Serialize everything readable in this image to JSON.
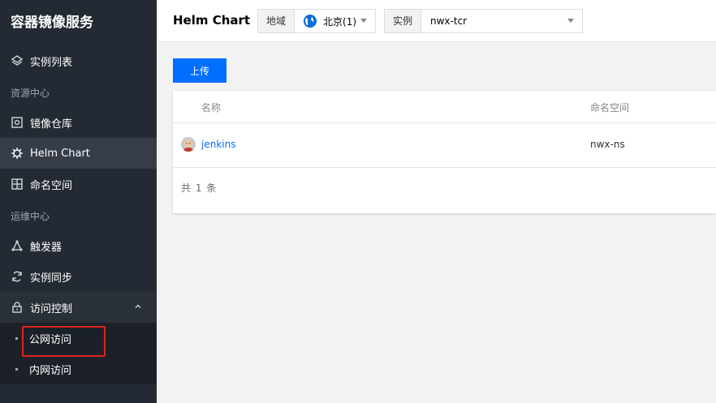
{
  "sidebar": {
    "app_title": "容器镜像服务",
    "top_item": {
      "label": "实例列表",
      "icon": "layers-icon"
    },
    "group_resources": "资源中心",
    "resources": [
      {
        "label": "镜像仓库",
        "icon": "repository-icon"
      },
      {
        "label": "Helm Chart",
        "icon": "helm-icon"
      },
      {
        "label": "命名空间",
        "icon": "namespace-icon"
      }
    ],
    "group_ops": "运维中心",
    "ops": [
      {
        "label": "触发器",
        "icon": "trigger-icon"
      },
      {
        "label": "实例同步",
        "icon": "sync-icon"
      },
      {
        "label": "访问控制",
        "icon": "lock-icon"
      }
    ],
    "access_sub": [
      {
        "label": "公网访问"
      },
      {
        "label": "内网访问"
      }
    ]
  },
  "header": {
    "title": "Helm Chart",
    "region_label": "地域",
    "region_value": "北京(1)",
    "instance_label": "实例",
    "instance_value": "nwx-tcr"
  },
  "toolbar": {
    "upload_label": "上传"
  },
  "table": {
    "columns": [
      "名称",
      "命名空间"
    ],
    "rows": [
      {
        "name": "jenkins",
        "namespace": "nwx-ns"
      }
    ],
    "total_text": "共 1 条"
  },
  "colors": {
    "accent": "#006eff",
    "sidebar_bg": "#242a33",
    "highlight": "#e1251b"
  }
}
